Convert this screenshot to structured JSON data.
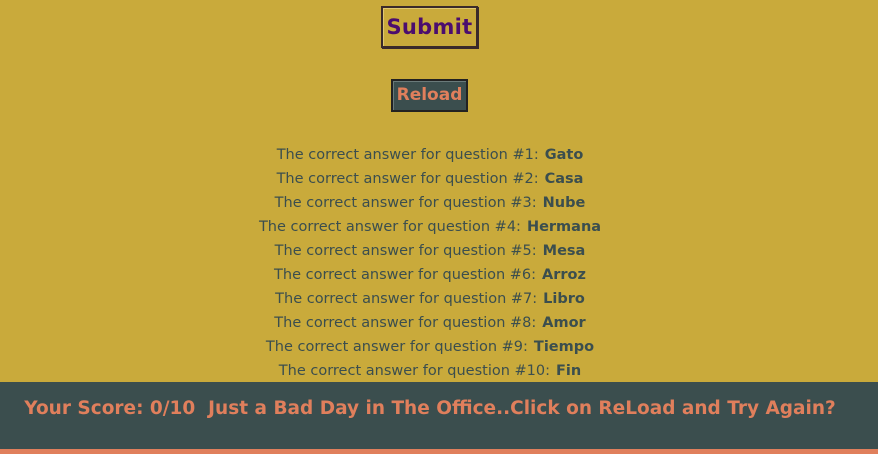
{
  "buttons": {
    "submit_label": "Submit",
    "reload_label": "Reload"
  },
  "answers": [
    {
      "prefix": "The correct answer for question #1:",
      "word": "Gato"
    },
    {
      "prefix": "The correct answer for question #2:",
      "word": "Casa"
    },
    {
      "prefix": "The correct answer for question #3:",
      "word": "Nube"
    },
    {
      "prefix": "The correct answer for question #4:",
      "word": "Hermana"
    },
    {
      "prefix": "The correct answer for question #5:",
      "word": "Mesa"
    },
    {
      "prefix": "The correct answer for question #6:",
      "word": "Arroz"
    },
    {
      "prefix": "The correct answer for question #7:",
      "word": "Libro"
    },
    {
      "prefix": "The correct answer for question #8:",
      "word": "Amor"
    },
    {
      "prefix": "The correct answer for question #9:",
      "word": "Tiempo"
    },
    {
      "prefix": "The correct answer for question #10:",
      "word": "Fin"
    }
  ],
  "score": {
    "text": "Your Score: 0/10  Just a Bad Day in The Office..Click on ReLoad and Try Again?"
  },
  "colors": {
    "background": "#c9aa3b",
    "panel": "#3b4e4e",
    "accent": "#e07f5c",
    "submit_text": "#4b0d6e"
  }
}
